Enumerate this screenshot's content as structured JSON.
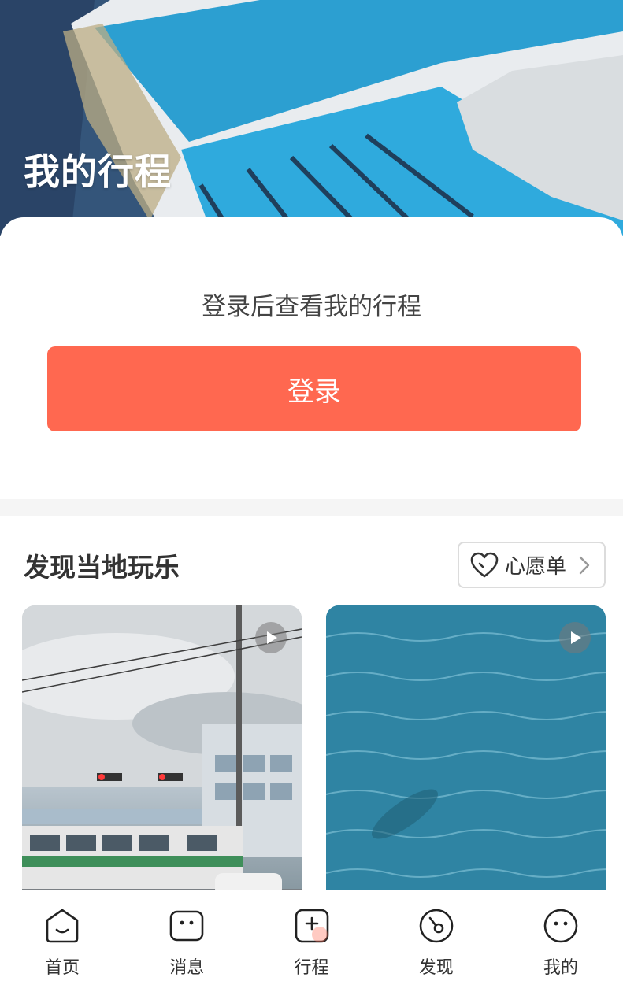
{
  "hero": {
    "title": "我的行程"
  },
  "login": {
    "prompt": "登录后查看我的行程",
    "button_label": "登录",
    "button_color": "#ff6850"
  },
  "discover": {
    "title": "发现当地玩乐",
    "wishlist_label": "心愿单",
    "cards": [
      {
        "icon": "play-icon"
      },
      {
        "icon": "play-icon"
      }
    ]
  },
  "nav": {
    "items": [
      {
        "label": "首页",
        "icon": "home-icon"
      },
      {
        "label": "消息",
        "icon": "message-icon"
      },
      {
        "label": "行程",
        "icon": "trip-add-icon"
      },
      {
        "label": "发现",
        "icon": "discover-icon"
      },
      {
        "label": "我的",
        "icon": "profile-icon"
      }
    ]
  }
}
